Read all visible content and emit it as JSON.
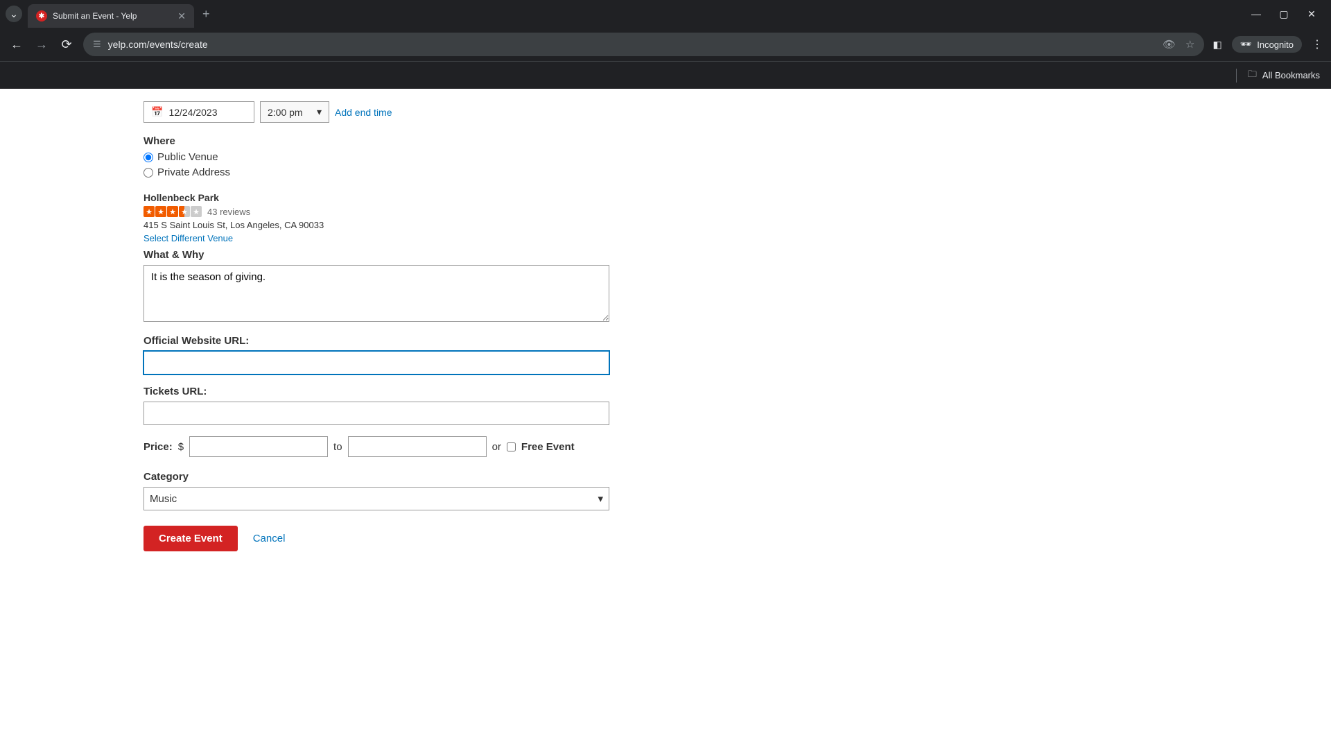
{
  "browser": {
    "tab_title": "Submit an Event - Yelp",
    "url": "yelp.com/events/create",
    "incognito_label": "Incognito",
    "all_bookmarks": "All Bookmarks"
  },
  "form": {
    "date": "12/24/2023",
    "time": "2:00 pm",
    "add_end_time": "Add end time",
    "where_label": "Where",
    "venue_options": {
      "public": "Public Venue",
      "private": "Private Address"
    },
    "venue": {
      "name": "Hollenbeck Park",
      "reviews": "43 reviews",
      "address": "415 S Saint Louis St, Los Angeles, CA 90033",
      "select_different": "Select Different Venue"
    },
    "what_why_label": "What & Why",
    "what_why_value": "It is the season of giving.",
    "official_url_label": "Official Website URL:",
    "official_url_value": "",
    "tickets_url_label": "Tickets URL:",
    "tickets_url_value": "",
    "price_label": "Price:",
    "price_currency": "$",
    "price_to": "to",
    "price_or": "or",
    "free_event_label": "Free Event",
    "category_label": "Category",
    "category_value": "Music",
    "create_button": "Create Event",
    "cancel_link": "Cancel"
  }
}
